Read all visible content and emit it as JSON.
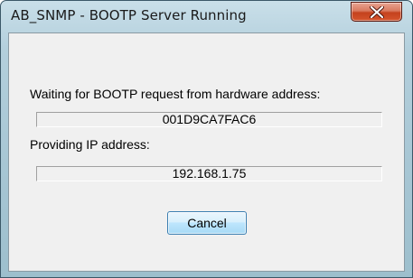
{
  "window": {
    "title": "AB_SNMP - BOOTP Server Running",
    "close_icon": "close-icon"
  },
  "dialog": {
    "waiting_label": "Waiting for BOOTP request from hardware address:",
    "hardware_address": "001D9CA7FAC6",
    "providing_label": "Providing IP address:",
    "ip_address": "192.168.1.75",
    "cancel_label": "Cancel"
  },
  "colors": {
    "frame": "#a7c6d4",
    "close_button": "#c4421e",
    "client_background": "#f0f0f0",
    "button_border": "#3c7fb1"
  }
}
